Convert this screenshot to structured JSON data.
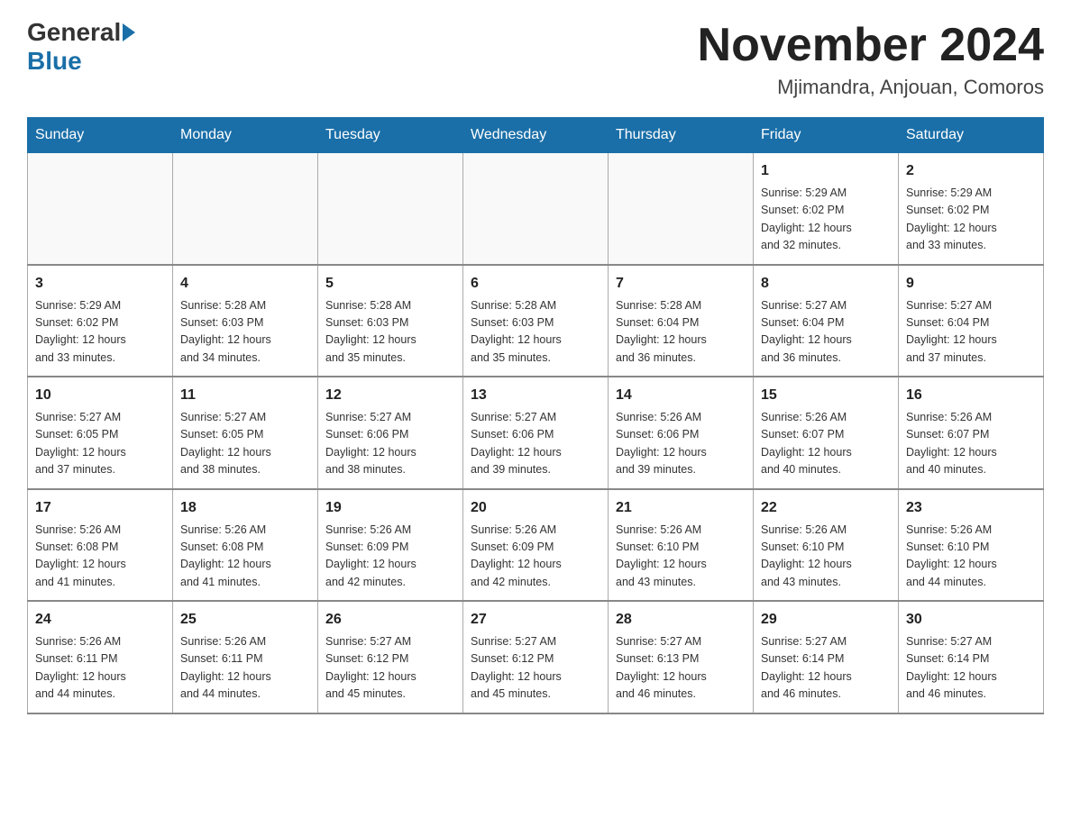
{
  "header": {
    "logo_general": "General",
    "logo_blue": "Blue",
    "month_title": "November 2024",
    "location": "Mjimandra, Anjouan, Comoros"
  },
  "calendar": {
    "days_of_week": [
      "Sunday",
      "Monday",
      "Tuesday",
      "Wednesday",
      "Thursday",
      "Friday",
      "Saturday"
    ],
    "weeks": [
      [
        {
          "day": "",
          "info": ""
        },
        {
          "day": "",
          "info": ""
        },
        {
          "day": "",
          "info": ""
        },
        {
          "day": "",
          "info": ""
        },
        {
          "day": "",
          "info": ""
        },
        {
          "day": "1",
          "info": "Sunrise: 5:29 AM\nSunset: 6:02 PM\nDaylight: 12 hours\nand 32 minutes."
        },
        {
          "day": "2",
          "info": "Sunrise: 5:29 AM\nSunset: 6:02 PM\nDaylight: 12 hours\nand 33 minutes."
        }
      ],
      [
        {
          "day": "3",
          "info": "Sunrise: 5:29 AM\nSunset: 6:02 PM\nDaylight: 12 hours\nand 33 minutes."
        },
        {
          "day": "4",
          "info": "Sunrise: 5:28 AM\nSunset: 6:03 PM\nDaylight: 12 hours\nand 34 minutes."
        },
        {
          "day": "5",
          "info": "Sunrise: 5:28 AM\nSunset: 6:03 PM\nDaylight: 12 hours\nand 35 minutes."
        },
        {
          "day": "6",
          "info": "Sunrise: 5:28 AM\nSunset: 6:03 PM\nDaylight: 12 hours\nand 35 minutes."
        },
        {
          "day": "7",
          "info": "Sunrise: 5:28 AM\nSunset: 6:04 PM\nDaylight: 12 hours\nand 36 minutes."
        },
        {
          "day": "8",
          "info": "Sunrise: 5:27 AM\nSunset: 6:04 PM\nDaylight: 12 hours\nand 36 minutes."
        },
        {
          "day": "9",
          "info": "Sunrise: 5:27 AM\nSunset: 6:04 PM\nDaylight: 12 hours\nand 37 minutes."
        }
      ],
      [
        {
          "day": "10",
          "info": "Sunrise: 5:27 AM\nSunset: 6:05 PM\nDaylight: 12 hours\nand 37 minutes."
        },
        {
          "day": "11",
          "info": "Sunrise: 5:27 AM\nSunset: 6:05 PM\nDaylight: 12 hours\nand 38 minutes."
        },
        {
          "day": "12",
          "info": "Sunrise: 5:27 AM\nSunset: 6:06 PM\nDaylight: 12 hours\nand 38 minutes."
        },
        {
          "day": "13",
          "info": "Sunrise: 5:27 AM\nSunset: 6:06 PM\nDaylight: 12 hours\nand 39 minutes."
        },
        {
          "day": "14",
          "info": "Sunrise: 5:26 AM\nSunset: 6:06 PM\nDaylight: 12 hours\nand 39 minutes."
        },
        {
          "day": "15",
          "info": "Sunrise: 5:26 AM\nSunset: 6:07 PM\nDaylight: 12 hours\nand 40 minutes."
        },
        {
          "day": "16",
          "info": "Sunrise: 5:26 AM\nSunset: 6:07 PM\nDaylight: 12 hours\nand 40 minutes."
        }
      ],
      [
        {
          "day": "17",
          "info": "Sunrise: 5:26 AM\nSunset: 6:08 PM\nDaylight: 12 hours\nand 41 minutes."
        },
        {
          "day": "18",
          "info": "Sunrise: 5:26 AM\nSunset: 6:08 PM\nDaylight: 12 hours\nand 41 minutes."
        },
        {
          "day": "19",
          "info": "Sunrise: 5:26 AM\nSunset: 6:09 PM\nDaylight: 12 hours\nand 42 minutes."
        },
        {
          "day": "20",
          "info": "Sunrise: 5:26 AM\nSunset: 6:09 PM\nDaylight: 12 hours\nand 42 minutes."
        },
        {
          "day": "21",
          "info": "Sunrise: 5:26 AM\nSunset: 6:10 PM\nDaylight: 12 hours\nand 43 minutes."
        },
        {
          "day": "22",
          "info": "Sunrise: 5:26 AM\nSunset: 6:10 PM\nDaylight: 12 hours\nand 43 minutes."
        },
        {
          "day": "23",
          "info": "Sunrise: 5:26 AM\nSunset: 6:10 PM\nDaylight: 12 hours\nand 44 minutes."
        }
      ],
      [
        {
          "day": "24",
          "info": "Sunrise: 5:26 AM\nSunset: 6:11 PM\nDaylight: 12 hours\nand 44 minutes."
        },
        {
          "day": "25",
          "info": "Sunrise: 5:26 AM\nSunset: 6:11 PM\nDaylight: 12 hours\nand 44 minutes."
        },
        {
          "day": "26",
          "info": "Sunrise: 5:27 AM\nSunset: 6:12 PM\nDaylight: 12 hours\nand 45 minutes."
        },
        {
          "day": "27",
          "info": "Sunrise: 5:27 AM\nSunset: 6:12 PM\nDaylight: 12 hours\nand 45 minutes."
        },
        {
          "day": "28",
          "info": "Sunrise: 5:27 AM\nSunset: 6:13 PM\nDaylight: 12 hours\nand 46 minutes."
        },
        {
          "day": "29",
          "info": "Sunrise: 5:27 AM\nSunset: 6:14 PM\nDaylight: 12 hours\nand 46 minutes."
        },
        {
          "day": "30",
          "info": "Sunrise: 5:27 AM\nSunset: 6:14 PM\nDaylight: 12 hours\nand 46 minutes."
        }
      ]
    ]
  }
}
